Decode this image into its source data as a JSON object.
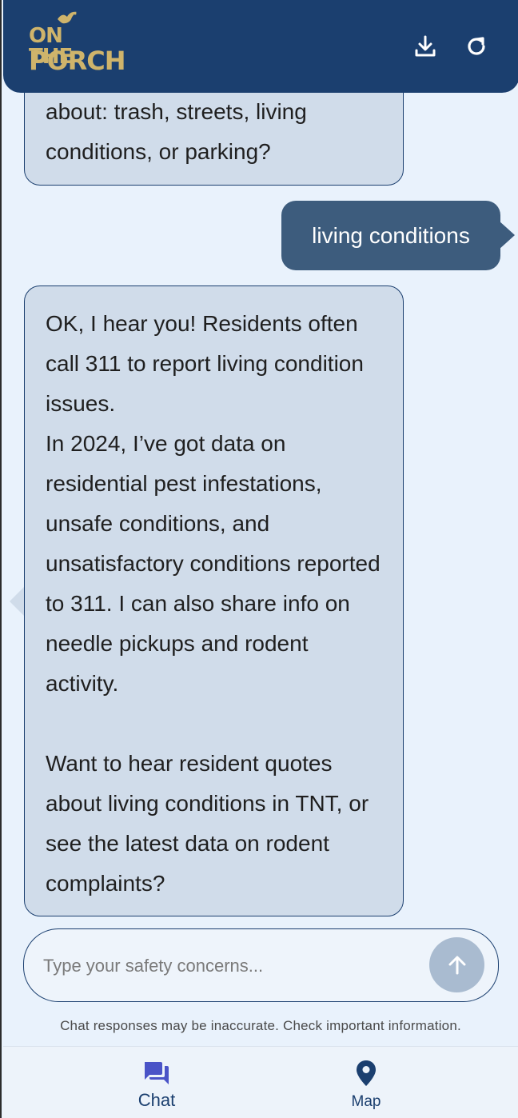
{
  "header": {
    "logo_line1": "ON THE",
    "logo_line2": "PORCH",
    "download_icon": "download-icon",
    "refresh_icon": "refresh-icon"
  },
  "messages": [
    {
      "role": "assistant",
      "text": "about: trash, streets, living conditions, or parking?"
    },
    {
      "role": "user",
      "text": "living conditions"
    },
    {
      "role": "assistant",
      "text": "OK, I hear you! Residents often call 311 to report living condition issues.\nIn 2024, I’ve got data on residential pest infestations, unsafe conditions, and unsatisfactory conditions reported to 311. I can also share info on needle pickups and rodent activity.\n\nWant to hear resident quotes about living conditions in TNT, or see the latest data on rodent complaints?"
    }
  ],
  "composer": {
    "placeholder": "Type your safety concerns...",
    "value": "",
    "send_icon": "arrow-up-icon"
  },
  "disclaimer": "Chat responses may be inaccurate. Check important information.",
  "nav": {
    "items": [
      {
        "label": "Chat",
        "icon": "chat-icon",
        "active": true
      },
      {
        "label": "Map",
        "icon": "map-pin-icon",
        "active": false
      }
    ]
  },
  "colors": {
    "header_bg": "#1b3f6f",
    "page_bg": "#e9f2fc",
    "assistant_bubble": "#d0dcea",
    "user_bubble": "#3d5c7d",
    "logo_gold": "#cfb46b",
    "nav_active": "#4a53c7"
  }
}
